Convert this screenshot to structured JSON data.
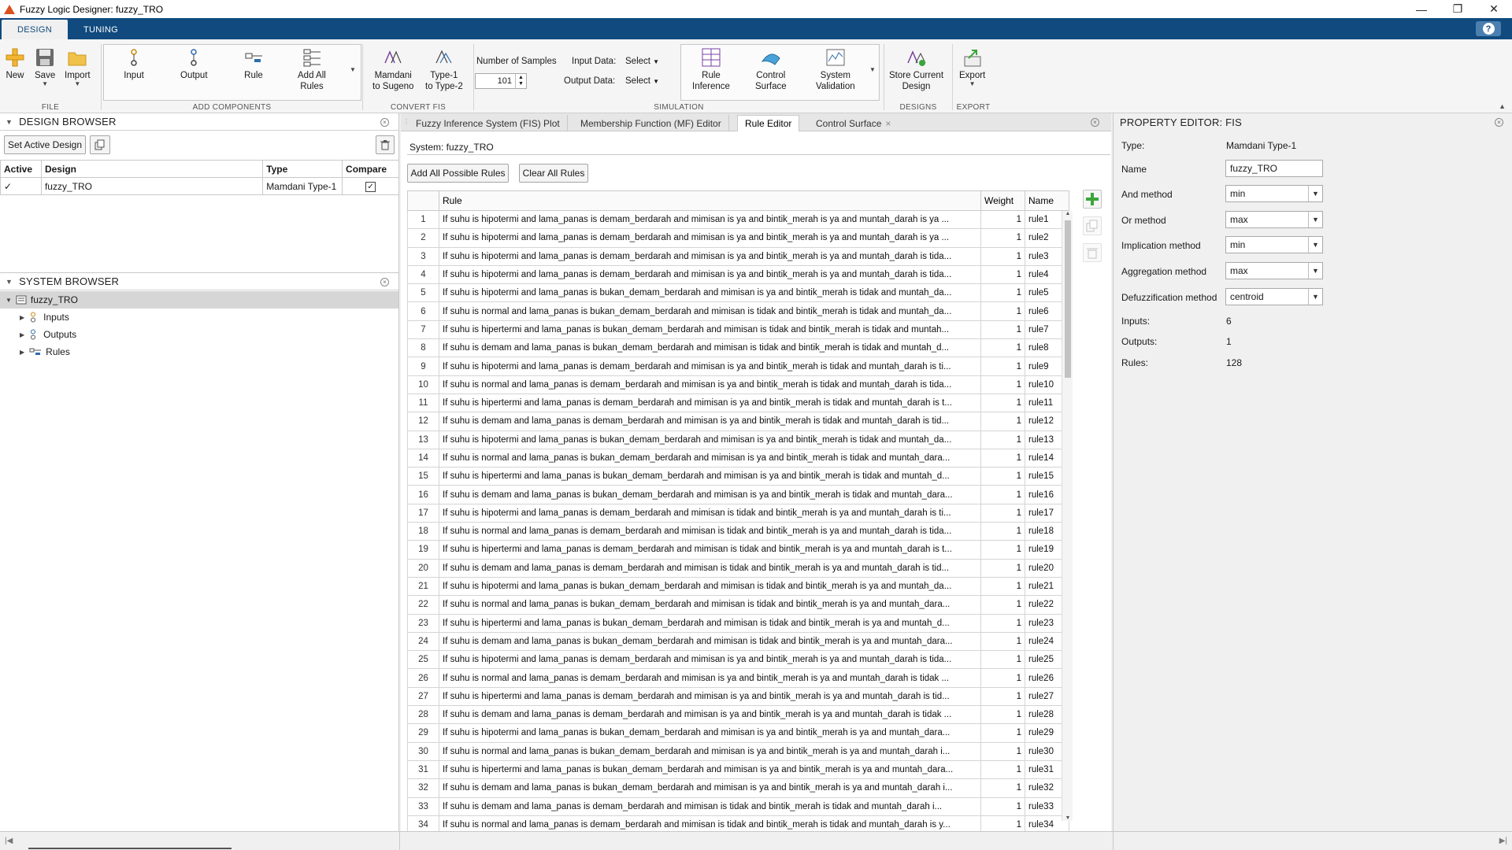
{
  "window": {
    "title": "Fuzzy Logic Designer: fuzzy_TRO"
  },
  "ribbon": {
    "tabs": [
      "DESIGN",
      "TUNING"
    ],
    "help": "?",
    "file": {
      "label": "FILE",
      "new": "New",
      "save": "Save",
      "import": "Import"
    },
    "add_components": {
      "label": "ADD COMPONENTS",
      "input": "Input",
      "output": "Output",
      "rule": "Rule",
      "add_all_1": "Add All",
      "add_all_2": "Rules"
    },
    "convert": {
      "label": "CONVERT FIS",
      "m2s_1": "Mamdani",
      "m2s_2": "to Sugeno",
      "t1_1": "Type-1",
      "t1_2": "to Type-2"
    },
    "simulation": {
      "label": "SIMULATION",
      "samples_label": "Number of Samples",
      "samples_value": "101",
      "input_data_label": "Input Data:",
      "input_data_value": "Select",
      "output_data_label": "Output Data:",
      "output_data_value": "Select",
      "rule_inference_1": "Rule",
      "rule_inference_2": "Inference",
      "control_surface_1": "Control",
      "control_surface_2": "Surface",
      "system_validation_1": "System",
      "system_validation_2": "Validation"
    },
    "designs": {
      "label": "DESIGNS",
      "store_1": "Store Current",
      "store_2": "Design"
    },
    "export": {
      "label": "EXPORT",
      "export": "Export"
    }
  },
  "design_browser": {
    "title": "DESIGN BROWSER",
    "set_active": "Set Active Design",
    "columns": [
      "Active",
      "Design",
      "Type",
      "Compare"
    ],
    "rows": [
      {
        "active": "✓",
        "design": "fuzzy_TRO",
        "type": "Mamdani Type-1",
        "compare": "✓"
      }
    ]
  },
  "system_browser": {
    "title": "SYSTEM BROWSER",
    "root": "fuzzy_TRO",
    "children": [
      "Inputs",
      "Outputs",
      "Rules"
    ]
  },
  "doc_tabs": [
    "Fuzzy Inference System (FIS) Plot",
    "Membership Function (MF) Editor",
    "Rule Editor",
    "Control Surface"
  ],
  "rule_editor": {
    "system_label": "System: fuzzy_TRO",
    "add_all_btn": "Add All Possible Rules",
    "clear_all_btn": "Clear All Rules",
    "columns": [
      "",
      "Rule",
      "Weight",
      "Name"
    ],
    "rules": [
      {
        "n": "1",
        "rule": "If suhu is hipotermi and lama_panas is demam_berdarah and mimisan is ya and bintik_merah is ya and muntah_darah is ya ...",
        "w": "1",
        "name": "rule1"
      },
      {
        "n": "2",
        "rule": "If suhu is hipotermi and lama_panas is demam_berdarah and mimisan is ya and bintik_merah is ya and muntah_darah is ya ...",
        "w": "1",
        "name": "rule2"
      },
      {
        "n": "3",
        "rule": "If suhu is hipotermi and lama_panas is demam_berdarah and mimisan is ya and bintik_merah is ya and muntah_darah is tida...",
        "w": "1",
        "name": "rule3"
      },
      {
        "n": "4",
        "rule": "If suhu is hipotermi and lama_panas is demam_berdarah and mimisan is ya and bintik_merah is ya and muntah_darah is tida...",
        "w": "1",
        "name": "rule4"
      },
      {
        "n": "5",
        "rule": "If suhu is hipotermi and lama_panas is bukan_demam_berdarah and mimisan is ya and bintik_merah is tidak and muntah_da...",
        "w": "1",
        "name": "rule5"
      },
      {
        "n": "6",
        "rule": "If suhu is normal and lama_panas is bukan_demam_berdarah and mimisan is tidak and bintik_merah is tidak and muntah_da...",
        "w": "1",
        "name": "rule6"
      },
      {
        "n": "7",
        "rule": "If suhu is hipertermi and lama_panas is bukan_demam_berdarah and mimisan is tidak and bintik_merah is tidak and muntah...",
        "w": "1",
        "name": "rule7"
      },
      {
        "n": "8",
        "rule": "If suhu is demam and lama_panas is bukan_demam_berdarah and mimisan is tidak and bintik_merah is tidak and muntah_d...",
        "w": "1",
        "name": "rule8"
      },
      {
        "n": "9",
        "rule": "If suhu is hipotermi and lama_panas is demam_berdarah and mimisan is ya and bintik_merah is tidak and muntah_darah is ti...",
        "w": "1",
        "name": "rule9"
      },
      {
        "n": "10",
        "rule": "If suhu is normal and lama_panas is demam_berdarah and mimisan is ya and bintik_merah is tidak and muntah_darah is tida...",
        "w": "1",
        "name": "rule10"
      },
      {
        "n": "11",
        "rule": "If suhu is hipertermi and lama_panas is demam_berdarah and mimisan is ya and bintik_merah is tidak and muntah_darah is t...",
        "w": "1",
        "name": "rule11"
      },
      {
        "n": "12",
        "rule": "If suhu is demam and lama_panas is demam_berdarah and mimisan is ya and bintik_merah is tidak and muntah_darah is tid...",
        "w": "1",
        "name": "rule12"
      },
      {
        "n": "13",
        "rule": "If suhu is hipotermi and lama_panas is bukan_demam_berdarah and mimisan is ya and bintik_merah is tidak and muntah_da...",
        "w": "1",
        "name": "rule13"
      },
      {
        "n": "14",
        "rule": "If suhu is normal and lama_panas is bukan_demam_berdarah and mimisan is ya and bintik_merah is tidak and muntah_dara...",
        "w": "1",
        "name": "rule14"
      },
      {
        "n": "15",
        "rule": "If suhu is hipertermi and lama_panas is bukan_demam_berdarah and mimisan is ya and bintik_merah is tidak and muntah_d...",
        "w": "1",
        "name": "rule15"
      },
      {
        "n": "16",
        "rule": "If suhu is demam and lama_panas is bukan_demam_berdarah and mimisan is ya and bintik_merah is tidak and muntah_dara...",
        "w": "1",
        "name": "rule16"
      },
      {
        "n": "17",
        "rule": "If suhu is hipotermi and lama_panas is demam_berdarah and mimisan is tidak and bintik_merah is ya and muntah_darah is ti...",
        "w": "1",
        "name": "rule17"
      },
      {
        "n": "18",
        "rule": "If suhu is normal and lama_panas is demam_berdarah and mimisan is tidak and bintik_merah is ya and muntah_darah is tida...",
        "w": "1",
        "name": "rule18"
      },
      {
        "n": "19",
        "rule": "If suhu is hipertermi and lama_panas is demam_berdarah and mimisan is tidak and bintik_merah is ya and muntah_darah is t...",
        "w": "1",
        "name": "rule19"
      },
      {
        "n": "20",
        "rule": "If suhu is demam and lama_panas is demam_berdarah and mimisan is tidak and bintik_merah is ya and muntah_darah is tid...",
        "w": "1",
        "name": "rule20"
      },
      {
        "n": "21",
        "rule": "If suhu is hipotermi and lama_panas is bukan_demam_berdarah and mimisan is tidak and bintik_merah is ya and muntah_da...",
        "w": "1",
        "name": "rule21"
      },
      {
        "n": "22",
        "rule": "If suhu is normal and lama_panas is bukan_demam_berdarah and mimisan is tidak and bintik_merah is ya and muntah_dara...",
        "w": "1",
        "name": "rule22"
      },
      {
        "n": "23",
        "rule": "If suhu is hipertermi and lama_panas is bukan_demam_berdarah and mimisan is tidak and bintik_merah is ya and muntah_d...",
        "w": "1",
        "name": "rule23"
      },
      {
        "n": "24",
        "rule": "If suhu is demam and lama_panas is bukan_demam_berdarah and mimisan is tidak and bintik_merah is ya and muntah_dara...",
        "w": "1",
        "name": "rule24"
      },
      {
        "n": "25",
        "rule": "If suhu is hipotermi and lama_panas is demam_berdarah and mimisan is ya and bintik_merah is ya and muntah_darah is tida...",
        "w": "1",
        "name": "rule25"
      },
      {
        "n": "26",
        "rule": "If suhu is normal and lama_panas is demam_berdarah and mimisan is ya and bintik_merah is ya and muntah_darah is tidak ...",
        "w": "1",
        "name": "rule26"
      },
      {
        "n": "27",
        "rule": "If suhu is hipertermi and lama_panas is demam_berdarah and mimisan is ya and bintik_merah is ya and muntah_darah is tid...",
        "w": "1",
        "name": "rule27"
      },
      {
        "n": "28",
        "rule": "If suhu is demam and lama_panas is demam_berdarah and mimisan is ya and bintik_merah is ya and muntah_darah is tidak ...",
        "w": "1",
        "name": "rule28"
      },
      {
        "n": "29",
        "rule": "If suhu is hipotermi and lama_panas is bukan_demam_berdarah and mimisan is ya and bintik_merah is ya and muntah_dara...",
        "w": "1",
        "name": "rule29"
      },
      {
        "n": "30",
        "rule": "If suhu is normal and lama_panas is bukan_demam_berdarah and mimisan is ya and bintik_merah is ya and muntah_darah i...",
        "w": "1",
        "name": "rule30"
      },
      {
        "n": "31",
        "rule": "If suhu is hipertermi and lama_panas is bukan_demam_berdarah and mimisan is ya and bintik_merah is ya and muntah_dara...",
        "w": "1",
        "name": "rule31"
      },
      {
        "n": "32",
        "rule": "If suhu is demam and lama_panas is bukan_demam_berdarah and mimisan is ya and bintik_merah is ya and muntah_darah i...",
        "w": "1",
        "name": "rule32"
      },
      {
        "n": "33",
        "rule": "If suhu is demam and lama_panas is demam_berdarah and mimisan is tidak and bintik_merah is tidak and muntah_darah i...",
        "w": "1",
        "name": "rule33"
      },
      {
        "n": "34",
        "rule": "If suhu is normal and lama_panas is demam_berdarah and mimisan is tidak and bintik_merah is tidak and muntah_darah is y...",
        "w": "1",
        "name": "rule34"
      }
    ]
  },
  "property_editor": {
    "title": "PROPERTY EDITOR: FIS",
    "type_label": "Type:",
    "type_value": "Mamdani Type-1",
    "name_label": "Name",
    "name_value": "fuzzy_TRO",
    "and_label": "And method",
    "and_value": "min",
    "or_label": "Or method",
    "or_value": "max",
    "imp_label": "Implication method",
    "imp_value": "min",
    "agg_label": "Aggregation method",
    "agg_value": "max",
    "defuzz_label": "Defuzzification method",
    "defuzz_value": "centroid",
    "inputs_label": "Inputs:",
    "inputs_value": "6",
    "outputs_label": "Outputs:",
    "outputs_value": "1",
    "rules_label": "Rules:",
    "rules_value": "128"
  },
  "colors": {
    "ribbon_blue": "#104a7e",
    "accent_orange": "#d9531e",
    "add_green": "#3aa63a"
  }
}
